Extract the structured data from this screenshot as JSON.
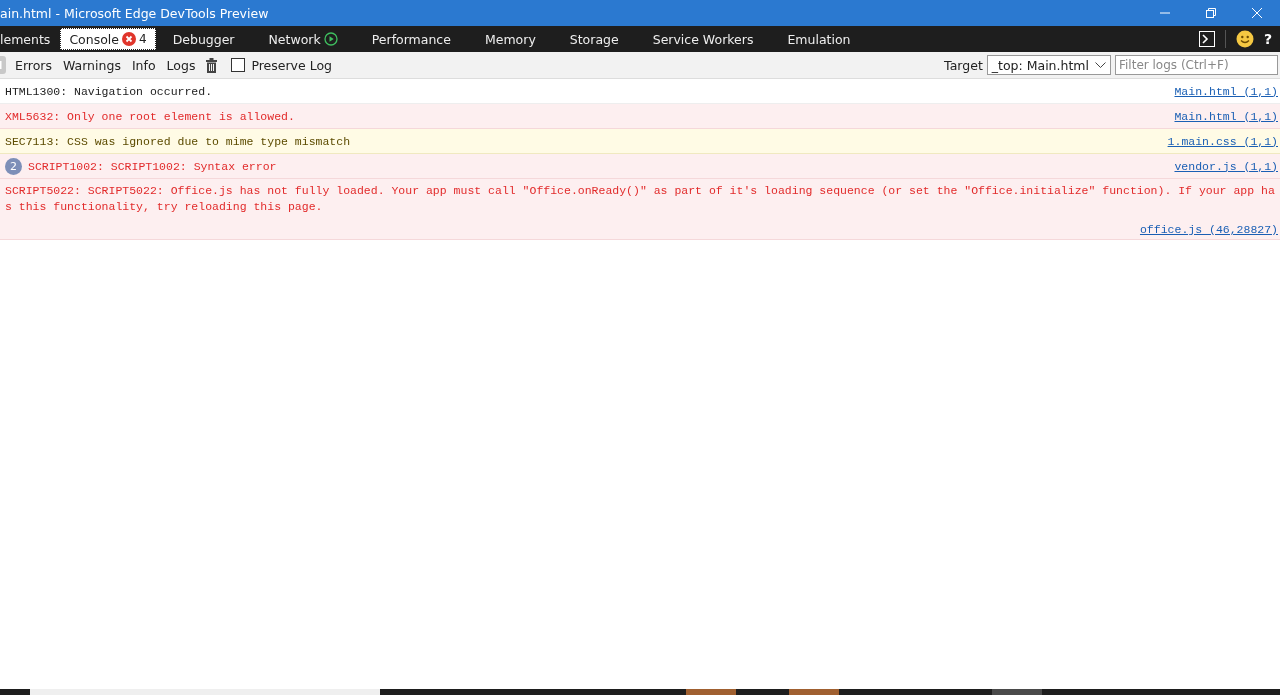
{
  "window": {
    "title": "ain.html - Microsoft Edge DevTools Preview"
  },
  "tabs": [
    {
      "label": "lements",
      "selected": false
    },
    {
      "label": "Console",
      "selected": true,
      "error_count": "4"
    },
    {
      "label": "Debugger",
      "selected": false
    },
    {
      "label": "Network",
      "selected": false,
      "recording": true
    },
    {
      "label": "Performance",
      "selected": false
    },
    {
      "label": "Memory",
      "selected": false
    },
    {
      "label": "Storage",
      "selected": false
    },
    {
      "label": "Service Workers",
      "selected": false
    },
    {
      "label": "Emulation",
      "selected": false
    }
  ],
  "help": "?",
  "toolbar": {
    "filters": [
      "Errors",
      "Warnings",
      "Info",
      "Logs"
    ],
    "preserve_log": {
      "label": "Preserve Log",
      "checked": false
    },
    "target_label": "Target",
    "target": "_top: Main.html",
    "filter": {
      "placeholder": "Filter logs (Ctrl+F)"
    }
  },
  "messages": [
    {
      "kind": "log",
      "text": "HTML1300: Navigation occurred.",
      "source": "Main.html (1,1)"
    },
    {
      "kind": "error",
      "text": "XML5632: Only one root element is allowed.",
      "source": "Main.html (1,1)"
    },
    {
      "kind": "warning",
      "text": "SEC7113: CSS was ignored due to mime type mismatch",
      "source": "1.main.css (1,1)"
    },
    {
      "kind": "error",
      "count": "2",
      "text": "SCRIPT1002: SCRIPT1002: Syntax error",
      "source": "vendor.js (1,1)"
    },
    {
      "kind": "error",
      "text": "SCRIPT5022: SCRIPT5022: Office.js has not fully loaded. Your app must call \"Office.onReady()\" as part of it's loading sequence (or set the \"Office.initialize\" function). If your app has this functionality, try reloading this page.",
      "source": "office.js (46,28827)",
      "source_below": true
    }
  ]
}
